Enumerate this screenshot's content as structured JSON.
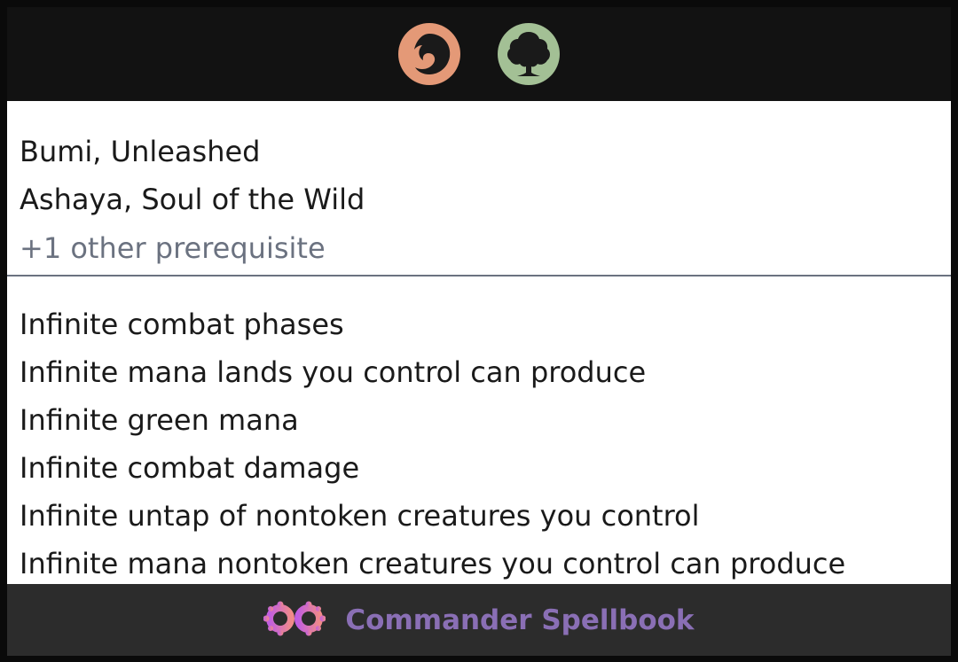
{
  "header": {
    "mana_icons": [
      {
        "name": "red-mana-icon",
        "color": "#e49977"
      },
      {
        "name": "green-mana-icon",
        "color": "#a3c095"
      }
    ]
  },
  "prerequisites": {
    "cards": [
      "Bumi, Unleashed",
      "Ashaya, Soul of the Wild"
    ],
    "more": "+1 other prerequisite"
  },
  "results": [
    "Infinite combat phases",
    "Infinite mana lands you control can produce",
    "Infinite green mana",
    "Infinite combat damage",
    "Infinite untap of nontoken creatures you control",
    "Infinite mana nontoken creatures you control can produce"
  ],
  "footer": {
    "brand": "Commander Spellbook",
    "logo_icon": "infinity-logo-icon",
    "brand_color": "#8a6fb5"
  }
}
